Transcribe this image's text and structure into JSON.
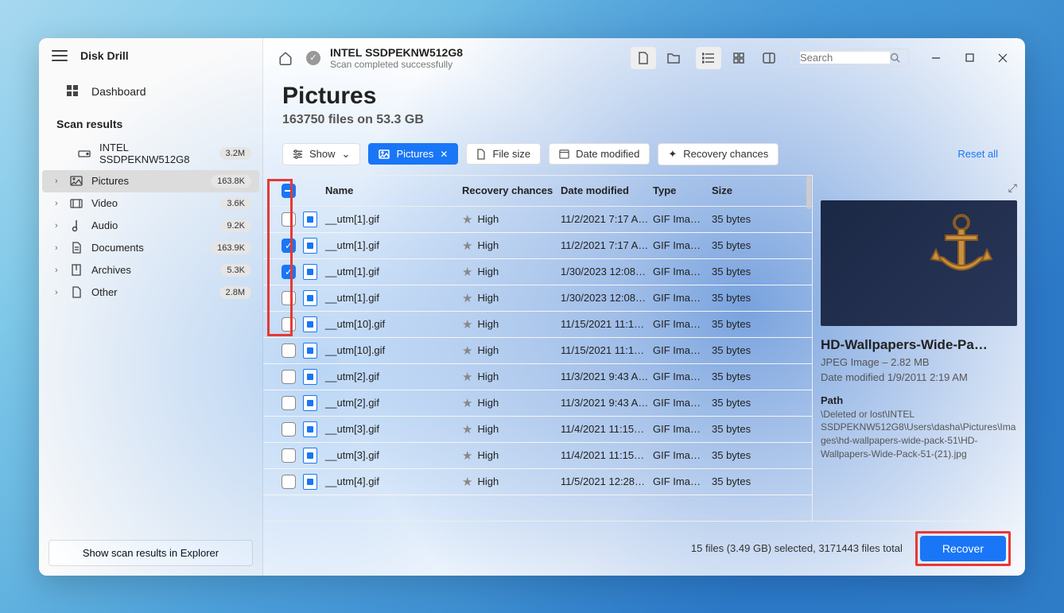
{
  "app": {
    "title": "Disk Drill"
  },
  "sidebar": {
    "dashboard": "Dashboard",
    "scan_results_title": "Scan results",
    "items": [
      {
        "label": "INTEL SSDPEKNW512G8",
        "badge": "3.2M",
        "icon": "drive"
      },
      {
        "label": "Pictures",
        "badge": "163.8K",
        "icon": "pictures",
        "active": true
      },
      {
        "label": "Video",
        "badge": "3.6K",
        "icon": "video"
      },
      {
        "label": "Audio",
        "badge": "9.2K",
        "icon": "audio"
      },
      {
        "label": "Documents",
        "badge": "163.9K",
        "icon": "documents"
      },
      {
        "label": "Archives",
        "badge": "5.3K",
        "icon": "archives"
      },
      {
        "label": "Other",
        "badge": "2.8M",
        "icon": "other"
      }
    ],
    "footer_btn": "Show scan results in Explorer"
  },
  "topbar": {
    "drive_title": "INTEL SSDPEKNW512G8",
    "drive_sub": "Scan completed successfully",
    "search_placeholder": "Search"
  },
  "page": {
    "title": "Pictures",
    "subtitle": "163750 files on 53.3 GB"
  },
  "filters": {
    "show": "Show",
    "pictures": "Pictures",
    "filesize": "File size",
    "datemod": "Date modified",
    "recchances": "Recovery chances",
    "reset": "Reset all"
  },
  "columns": {
    "name": "Name",
    "recovery": "Recovery chances",
    "date": "Date modified",
    "type": "Type",
    "size": "Size"
  },
  "rows": [
    {
      "checked": false,
      "name": "__utm[1].gif",
      "recovery": "High",
      "date": "11/2/2021 7:17 A…",
      "type": "GIF Ima…",
      "size": "35 bytes"
    },
    {
      "checked": true,
      "name": "__utm[1].gif",
      "recovery": "High",
      "date": "11/2/2021 7:17 A…",
      "type": "GIF Ima…",
      "size": "35 bytes"
    },
    {
      "checked": true,
      "name": "__utm[1].gif",
      "recovery": "High",
      "date": "1/30/2023 12:08…",
      "type": "GIF Ima…",
      "size": "35 bytes"
    },
    {
      "checked": false,
      "name": "__utm[1].gif",
      "recovery": "High",
      "date": "1/30/2023 12:08…",
      "type": "GIF Ima…",
      "size": "35 bytes"
    },
    {
      "checked": false,
      "name": "__utm[10].gif",
      "recovery": "High",
      "date": "11/15/2021 11:1…",
      "type": "GIF Ima…",
      "size": "35 bytes"
    },
    {
      "checked": false,
      "name": "__utm[10].gif",
      "recovery": "High",
      "date": "11/15/2021 11:1…",
      "type": "GIF Ima…",
      "size": "35 bytes"
    },
    {
      "checked": false,
      "name": "__utm[2].gif",
      "recovery": "High",
      "date": "11/3/2021 9:43 A…",
      "type": "GIF Ima…",
      "size": "35 bytes"
    },
    {
      "checked": false,
      "name": "__utm[2].gif",
      "recovery": "High",
      "date": "11/3/2021 9:43 A…",
      "type": "GIF Ima…",
      "size": "35 bytes"
    },
    {
      "checked": false,
      "name": "__utm[3].gif",
      "recovery": "High",
      "date": "11/4/2021 11:15…",
      "type": "GIF Ima…",
      "size": "35 bytes"
    },
    {
      "checked": false,
      "name": "__utm[3].gif",
      "recovery": "High",
      "date": "11/4/2021 11:15…",
      "type": "GIF Ima…",
      "size": "35 bytes"
    },
    {
      "checked": false,
      "name": "__utm[4].gif",
      "recovery": "High",
      "date": "11/5/2021 12:28…",
      "type": "GIF Ima…",
      "size": "35 bytes"
    }
  ],
  "preview": {
    "title": "HD-Wallpapers-Wide-Pa…",
    "meta": "JPEG Image – 2.82 MB",
    "date_label": "Date modified 1/9/2011 2:19 AM",
    "path_label": "Path",
    "path_value": "\\Deleted or lost\\INTEL SSDPEKNW512G8\\Users\\dasha\\Pictures\\Images\\hd-wallpapers-wide-pack-51\\HD-Wallpapers-Wide-Pack-51-(21).jpg"
  },
  "footer": {
    "status": "15 files (3.49 GB) selected, 3171443 files total",
    "recover": "Recover"
  }
}
